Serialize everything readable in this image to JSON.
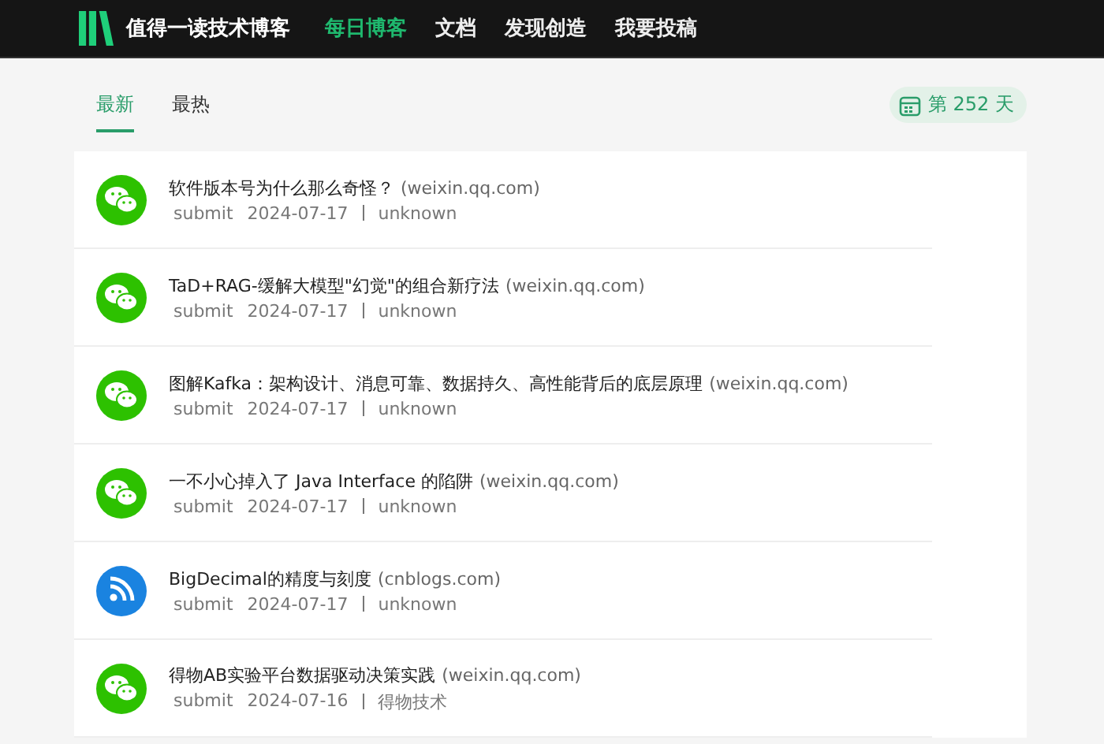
{
  "header": {
    "brand": "值得一读技术博客",
    "nav": [
      {
        "label": "每日博客",
        "selected": true
      },
      {
        "label": "文档",
        "selected": false
      },
      {
        "label": "发现创造",
        "selected": false
      },
      {
        "label": "我要投稿",
        "selected": false
      }
    ]
  },
  "tabs": [
    {
      "label": "最新",
      "selected": true
    },
    {
      "label": "最热",
      "selected": false
    }
  ],
  "day_badge": "第 252 天",
  "articles": [
    {
      "kind": "wechat",
      "title": "软件版本号为什么那么奇怪？",
      "source": "(weixin.qq.com)",
      "submitter": "submit",
      "date": "2024-07-17",
      "author": "unknown"
    },
    {
      "kind": "wechat",
      "title": "TaD+RAG-缓解大模型\"幻觉\"的组合新疗法",
      "source": "(weixin.qq.com)",
      "submitter": "submit",
      "date": "2024-07-17",
      "author": "unknown"
    },
    {
      "kind": "wechat",
      "title": "图解Kafka：架构设计、消息可靠、数据持久、高性能背后的底层原理",
      "source": "(weixin.qq.com)",
      "submitter": "submit",
      "date": "2024-07-17",
      "author": "unknown"
    },
    {
      "kind": "wechat",
      "title": "一不小心掉入了 Java Interface 的陷阱",
      "source": "(weixin.qq.com)",
      "submitter": "submit",
      "date": "2024-07-17",
      "author": "unknown"
    },
    {
      "kind": "rss",
      "title": "BigDecimal的精度与刻度",
      "source": "(cnblogs.com)",
      "submitter": "submit",
      "date": "2024-07-17",
      "author": "unknown"
    },
    {
      "kind": "wechat",
      "title": "得物AB实验平台数据驱动决策实践",
      "source": "(weixin.qq.com)",
      "submitter": "submit",
      "date": "2024-07-16",
      "author": "得物技术"
    }
  ]
}
